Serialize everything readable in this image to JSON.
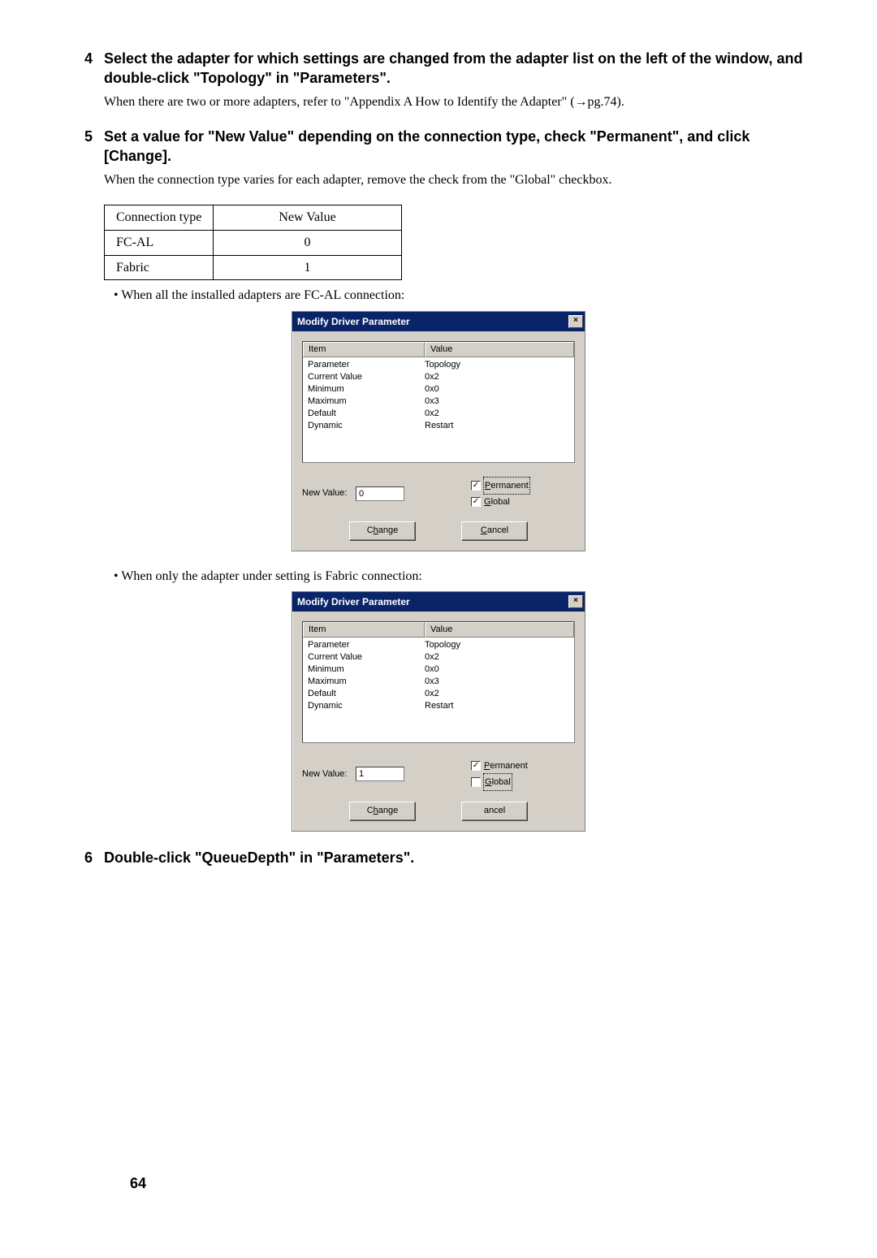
{
  "steps": {
    "s4": {
      "num": "4",
      "title": "Select the adapter for which settings are changed from the adapter list on the left of the window, and double-click \"Topology\" in \"Parameters\".",
      "body": "When there are two or more adapters, refer to \"Appendix A How to Identify the Adapter\" (→pg.74)."
    },
    "s5": {
      "num": "5",
      "title": "Set a value for \"New Value\" depending on the connection type, check \"Permanent\", and click [Change].",
      "body": "When the connection type varies for each adapter, remove the check from the \"Global\" checkbox."
    },
    "s6": {
      "num": "6",
      "title": "Double-click \"QueueDepth\" in \"Parameters\"."
    }
  },
  "conn_table": {
    "headers": {
      "c1": "Connection type",
      "c2": "New Value"
    },
    "rows": [
      {
        "c1": "FC-AL",
        "c2": "0"
      },
      {
        "c1": "Fabric",
        "c2": "1"
      }
    ]
  },
  "bullets": {
    "b1": "When all the installed adapters are FC-AL connection:",
    "b2": "When only the adapter under setting is Fabric connection:"
  },
  "dialog_common": {
    "title": "Modify Driver Parameter",
    "close": "×",
    "col_item": "Item",
    "col_value": "Value",
    "rows": [
      {
        "item": "Parameter",
        "value": "Topology"
      },
      {
        "item": "Current Value",
        "value": "0x2"
      },
      {
        "item": "Minimum",
        "value": "0x0"
      },
      {
        "item": "Maximum",
        "value": "0x3"
      },
      {
        "item": "Default",
        "value": "0x2"
      },
      {
        "item": "Dynamic",
        "value": "Restart"
      }
    ],
    "newvalue_label": "New Value:",
    "permanent_label_ul": "P",
    "permanent_label_rest": "ermanent",
    "global_label_ul": "G",
    "global_label_rest": "lobal",
    "btn_change_ul": "h",
    "btn_change_pre": "C",
    "btn_change_post": "ange",
    "btn_cancel_ul": "C",
    "btn_cancel_post": "ancel"
  },
  "dialog1": {
    "newvalue": "0",
    "permanent_checked": "✓",
    "global_checked": "✓",
    "permanent_dotted": true,
    "global_dotted": false
  },
  "dialog2": {
    "newvalue": "1",
    "permanent_checked": "✓",
    "global_checked": "",
    "permanent_dotted": false,
    "global_dotted": true
  },
  "page_number": "64"
}
